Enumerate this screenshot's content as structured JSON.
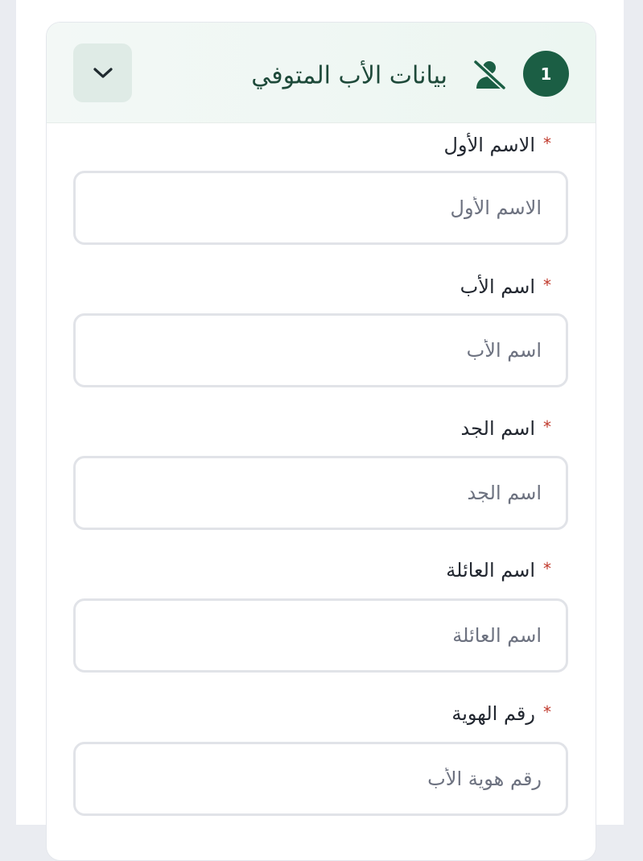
{
  "section": {
    "step_number": "1",
    "title": "بيانات الأب المتوفي",
    "icon": "person-off-icon",
    "collapse_icon": "chevron-down-icon",
    "accent_color": "#1b5e44"
  },
  "fields": [
    {
      "label": "الاسم الأول",
      "required_mark": "*",
      "placeholder": "الاسم الأول",
      "value": ""
    },
    {
      "label": "اسم الأب",
      "required_mark": "*",
      "placeholder": "اسم الأب",
      "value": ""
    },
    {
      "label": "اسم الجد",
      "required_mark": "*",
      "placeholder": "اسم الجد",
      "value": ""
    },
    {
      "label": "اسم العائلة",
      "required_mark": "*",
      "placeholder": "اسم العائلة",
      "value": ""
    },
    {
      "label": "رقم الهوية",
      "required_mark": "*",
      "placeholder": "رقم هوية الأب",
      "value": ""
    }
  ]
}
